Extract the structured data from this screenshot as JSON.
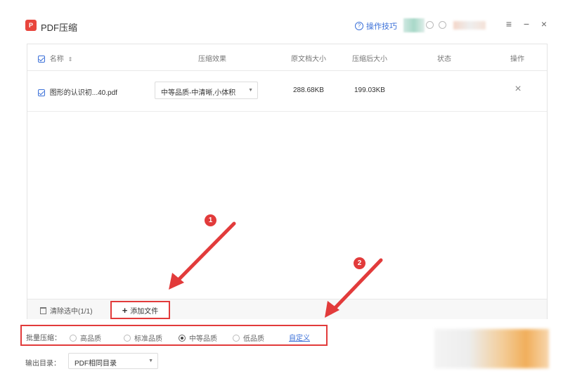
{
  "app": {
    "logo_text": "P",
    "title": "PDF压缩",
    "tips_icon": "?",
    "tips_label": "操作技巧"
  },
  "window_controls": {
    "menu": "≡",
    "minimize": "−",
    "close": "×"
  },
  "table": {
    "headers": {
      "name": "名称",
      "effect": "压缩效果",
      "original_size": "原文档大小",
      "compressed_size": "压缩后大小",
      "status": "状态",
      "action": "操作"
    },
    "rows": [
      {
        "name": "图形的认识初...40.pdf",
        "effect": "中等品质-中清晰,小体积",
        "original_size": "288.68KB",
        "compressed_size": "199.03KB",
        "status": "",
        "action": "×"
      }
    ]
  },
  "footer": {
    "clear_label": "清除选中(1/1)",
    "add_label": "添加文件"
  },
  "batch": {
    "label": "批量压缩：",
    "options": [
      "高品质",
      "标准品质",
      "中等品质",
      "低品质"
    ],
    "selected": "中等品质",
    "custom_label": "自定义"
  },
  "output": {
    "label": "输出目录：",
    "value": "PDF相同目录"
  },
  "annotations": {
    "badge1": "1",
    "badge2": "2",
    "accent_color": "#e23b3b"
  },
  "colors": {
    "link": "#3a6fd8",
    "logo": "#e8453c"
  }
}
